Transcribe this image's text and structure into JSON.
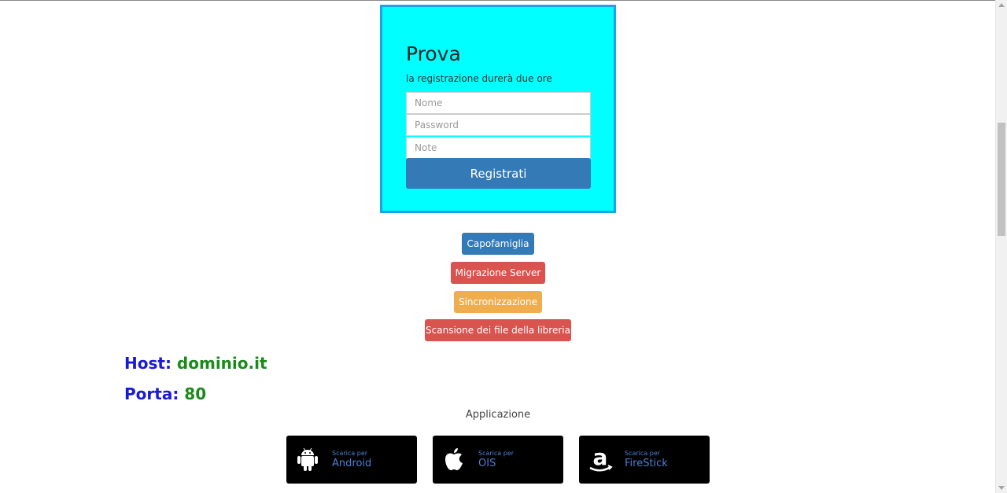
{
  "registration": {
    "title": "Prova",
    "subtitle": "la registrazione durerà due ore",
    "fields": {
      "name_placeholder": "Nome",
      "password_placeholder": "Password",
      "note_placeholder": "Note"
    },
    "submit_label": "Registrati"
  },
  "actions": {
    "capofamiglia": "Capofamiglia",
    "migrazione": "Migrazione Server",
    "sincronizzazione": "Sincronizzazione",
    "scansione": "Scansione dei file della libreria"
  },
  "server": {
    "host_label": "Host:",
    "host_value": "dominio.it",
    "port_label": "Porta:",
    "port_value": "80"
  },
  "apps": {
    "section_label": "Applicazione",
    "items": [
      {
        "small": "Scarica per",
        "name": "Android",
        "icon": "android-icon"
      },
      {
        "small": "Scarica per",
        "name": "OIS",
        "icon": "apple-icon"
      },
      {
        "small": "Scarica per",
        "name": "FireStick",
        "icon": "amazon-icon"
      }
    ]
  },
  "colors": {
    "form_bg": "#00ffff",
    "form_border": "#1aa3e6",
    "primary": "#337ab7",
    "danger": "#d9534f",
    "warning": "#f0ad4e",
    "host_label": "#1a1ad4",
    "host_value": "#1a8a1a"
  }
}
